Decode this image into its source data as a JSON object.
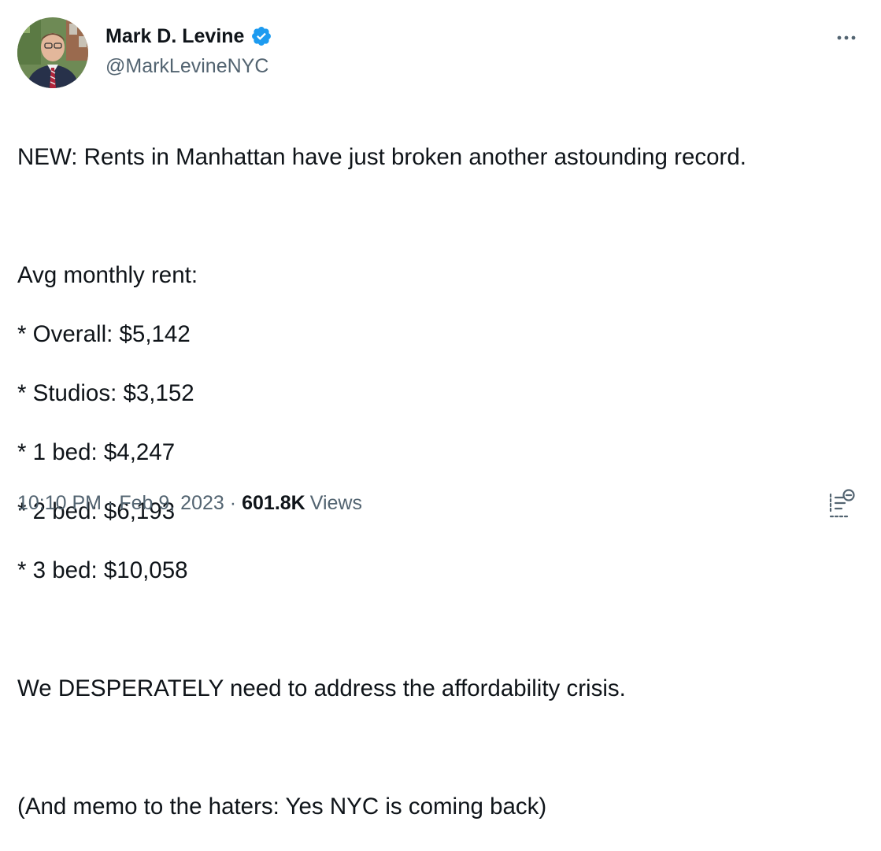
{
  "author": {
    "display_name": "Mark D. Levine",
    "handle": "@MarkLevineNYC",
    "verified_icon": "verified-badge-icon",
    "verified_color": "#1d9bf0"
  },
  "tweet": {
    "line1": "NEW: Rents in Manhattan have just broken another astounding record.",
    "rent_heading": "Avg monthly rent:",
    "rent_items": [
      "* Overall: $5,142",
      "* Studios: $3,152",
      "* 1 bed: $4,247",
      "* 2 bed: $6,193",
      "* 3 bed: $10,058"
    ],
    "line_crisis": "We DESPERATELY need to address the affordability crisis.",
    "line_memo": "(And memo to the haters: Yes NYC is coming back)"
  },
  "meta": {
    "time": "10:10 PM",
    "separator": "·",
    "date": "Feb 9, 2023",
    "views_count": "601.8K",
    "views_label": "Views"
  },
  "colors": {
    "text_primary": "#0f1419",
    "text_secondary": "#536471",
    "accent": "#1d9bf0"
  },
  "icons": {
    "more": "more-options-icon",
    "analytics": "analytics-icon"
  }
}
